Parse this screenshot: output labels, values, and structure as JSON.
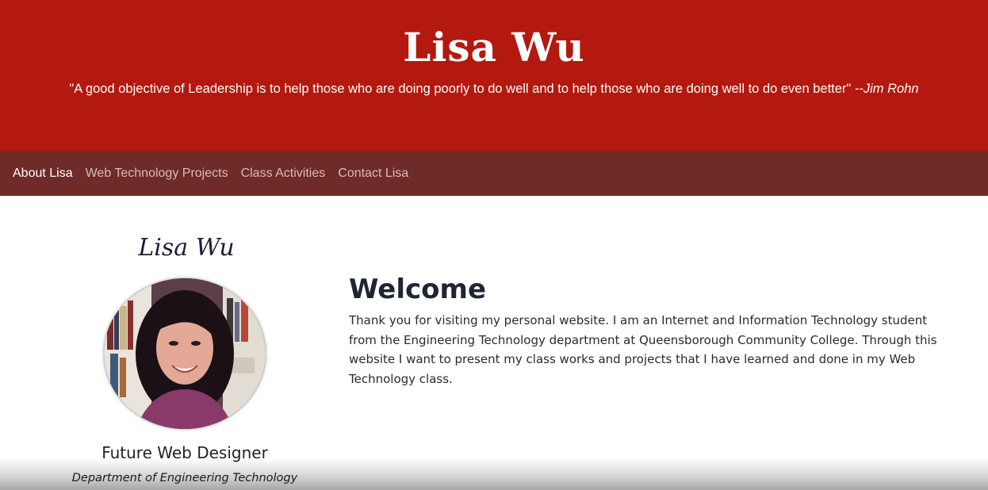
{
  "header": {
    "title": "Lisa Wu",
    "quote": "\"A good objective of Leadership is to help those who are doing poorly to do well and to help those who are doing well to do even better\"",
    "quote_author": "--Jim Rohn"
  },
  "nav": {
    "items": [
      {
        "label": "About Lisa",
        "active": true
      },
      {
        "label": "Web Technology Projects",
        "active": false
      },
      {
        "label": "Class Activities",
        "active": false
      },
      {
        "label": "Contact Lisa",
        "active": false
      }
    ]
  },
  "sidebar": {
    "signature_name": "Lisa Wu",
    "role": "Future Web Designer",
    "department": "Department of Engineering Technology"
  },
  "main": {
    "heading": "Welcome",
    "paragraph": "Thank you for visiting my personal website. I am an Internet and Information Technology student from the Engineering Technology department at Queensborough Community College. Through this website I want to present my class works and projects that I have learned and done in my Web Technology class."
  },
  "colors": {
    "header_bg": "#b3190e",
    "nav_bg": "#6e2b27",
    "nav_active": "#ffffff",
    "nav_inactive": "#d9bdb9"
  }
}
